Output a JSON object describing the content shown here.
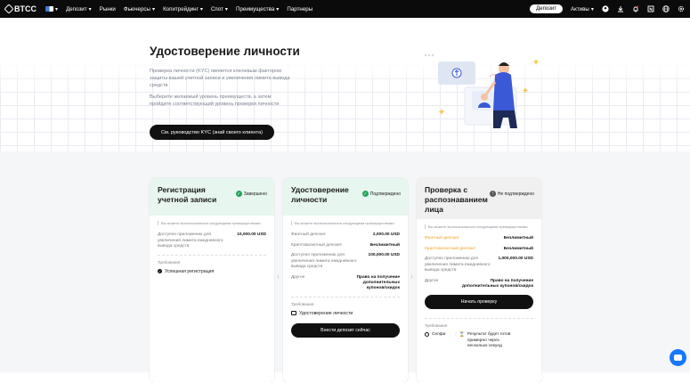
{
  "nav": {
    "brand": "BTCC",
    "items": [
      {
        "label": "Депозит",
        "dropdown": true
      },
      {
        "label": "Рынки",
        "dropdown": false
      },
      {
        "label": "Фьючерсы",
        "dropdown": true
      },
      {
        "label": "Копитрейдинг",
        "dropdown": true
      },
      {
        "label": "Спот",
        "dropdown": true
      },
      {
        "label": "Преимущества",
        "dropdown": true
      },
      {
        "label": "Партнеры",
        "dropdown": false
      }
    ],
    "deposit_button": "Депозит",
    "assets_label": "Активы",
    "icons": [
      "user-icon",
      "download-icon",
      "bell-icon",
      "notes-icon",
      "globe-icon",
      "settings-icon"
    ]
  },
  "hero": {
    "title": "Удостоверение личности",
    "desc1": "Проверка личности (KYC) является ключевым фактором защиты вашей учетной записи и увеличения лимита вывода средств",
    "desc2": "Выберите желаемый уровень преимуществ, а затем пройдите соответствующий уровень проверки личности",
    "button": "См. руководство KYC (знай своего клиента)"
  },
  "cards": [
    {
      "title": "Регистрация учетной записи",
      "status": "Завершено",
      "header_color": "#e7f6ee",
      "note": "Вы можете воспользоваться следующими преимуществами",
      "rows": [
        {
          "label": "Доступно приложению для увеличения лимита ежедневного вывода средств",
          "value": "10,000.00 USD",
          "accent": false
        }
      ],
      "requirements_label": "Требования",
      "requirements": [
        {
          "label": "Успешная регистрация",
          "icon": "check-dot-icon"
        }
      ],
      "button": ""
    },
    {
      "title": "Удостоверение личности",
      "status": "Подтверждено",
      "header_color": "#e7f6ee",
      "note": "Вы можете воспользоваться следующими преимуществами",
      "rows": [
        {
          "label": "Фиатный депозит",
          "value": "2,000.00 USD",
          "accent": false
        },
        {
          "label": "Криптовалютный депозит",
          "value": "Безлимитный",
          "accent": false
        },
        {
          "label": "Доступно приложению для увеличения лимита ежедневного вывода средств",
          "value": "100,000.00 USD",
          "accent": false
        },
        {
          "label": "Другое",
          "value": "Право на получение дополнительных купонов/скидок",
          "accent": false
        }
      ],
      "requirements_label": "Требования",
      "requirements": [
        {
          "label": "Удостоверение личности",
          "icon": "id-card-icon"
        }
      ],
      "button": "Внести депозит сейчас"
    },
    {
      "title": "Проверка с распознаванием лица",
      "status": "Не подтверждено",
      "header_color": "#f0f0f0",
      "note": "Вы можете воспользоваться следующими преимуществами",
      "rows": [
        {
          "label": "Фиатный депозит",
          "value": "Безлимитный",
          "accent": true
        },
        {
          "label": "Криптовалютный депозит",
          "value": "Безлимитный",
          "accent": true
        },
        {
          "label": "Доступно приложению для увеличения лимита ежедневного вывода средств",
          "value": "1,000,000.00 USD",
          "accent": false
        },
        {
          "label": "Другое",
          "value": "Право на получение дополнительных купонов/скидок",
          "accent": false
        }
      ],
      "requirements_label": "Требования",
      "requirements": [
        {
          "label": "Селфи",
          "icon": "selfie-icon"
        },
        {
          "label": "Результат будет готов примерно через несколько секунд",
          "icon": "hourglass-icon"
        }
      ],
      "button": "Начать проверку"
    }
  ],
  "colors": {
    "accent_green": "#21a55a",
    "accent_orange": "#f0a020",
    "chat_blue": "#1677ff"
  }
}
